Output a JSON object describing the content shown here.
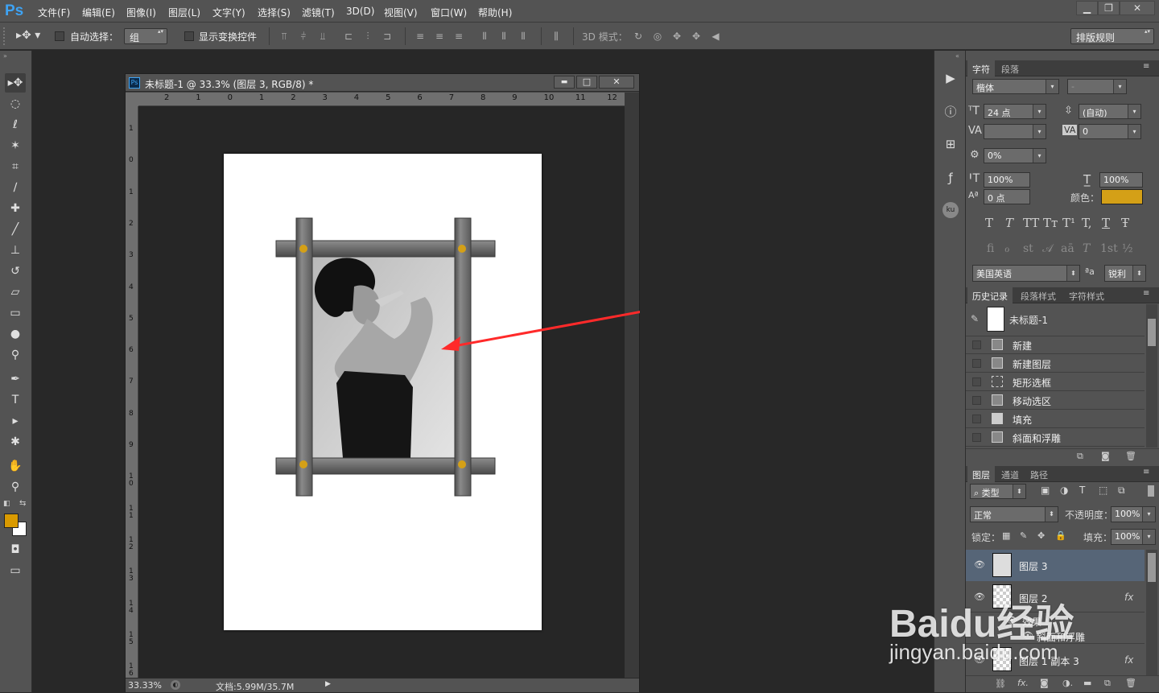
{
  "app": {
    "logo": "Ps"
  },
  "menu": [
    "文件(F)",
    "编辑(E)",
    "图像(I)",
    "图层(L)",
    "文字(Y)",
    "选择(S)",
    "滤镜(T)",
    "3D(D)",
    "视图(V)",
    "窗口(W)",
    "帮助(H)"
  ],
  "window_controls": {
    "minimize": "▁",
    "restore": "❐",
    "close": "✕"
  },
  "options": {
    "auto_select_label": "自动选择：",
    "auto_select_value": "组",
    "show_transform_label": "显示变换控件",
    "mode3d_label": "3D 模式：",
    "workspace": "排版规则"
  },
  "document": {
    "title": "未标题-1 @ 33.3% (图层 3, RGB/8) *",
    "icon": "Ps",
    "zoom": "33.33%",
    "doc_info": "文档:5.99M/35.7M",
    "ruler_top": [
      "2",
      "1",
      "0",
      "1",
      "2",
      "3",
      "4",
      "5",
      "6",
      "7",
      "8",
      "9",
      "10",
      "11",
      "12"
    ],
    "ruler_left": [
      "1",
      "0",
      "1",
      "2",
      "3",
      "4",
      "5",
      "6",
      "7",
      "8",
      "9",
      "10",
      "11",
      "12",
      "13",
      "14",
      "15",
      "16"
    ],
    "controls": {
      "minimize": "▬",
      "restore": "□",
      "close": "✕"
    }
  },
  "colors": {
    "foreground": "#d99a00",
    "background": "#ffffff",
    "accent": "#d4a017",
    "arrow": "#ff2a2a"
  },
  "character_panel": {
    "tabs": [
      "字符",
      "段落"
    ],
    "font_family": "楷体",
    "font_style": "-",
    "font_size": "24 点",
    "leading": "(自动)",
    "kerning": "",
    "tracking": "0",
    "scale_percent": "0%",
    "vscale": "100%",
    "hscale": "100%",
    "baseline": "0 点",
    "color_label": "颜色：",
    "type_buttons": [
      "T",
      "T",
      "TT",
      "Tт",
      "T¹",
      "T,",
      "T",
      "Ŧ"
    ],
    "opentype_buttons": [
      "fi",
      "ℴ",
      "st",
      "𝒜",
      "aā",
      "T",
      "1st",
      "½"
    ],
    "language": "美国英语",
    "aa_label": "ªa",
    "antialias": "锐利"
  },
  "history_panel": {
    "tabs": [
      "历史记录",
      "段落样式",
      "字符样式"
    ],
    "snapshot": "未标题-1",
    "steps": [
      "新建",
      "新建图层",
      "矩形选框",
      "移动选区",
      "填充",
      "斜面和浮雕"
    ]
  },
  "layers_panel": {
    "tabs": [
      "图层",
      "通道",
      "路径"
    ],
    "filter": "类型",
    "blend_mode": "正常",
    "opacity_label": "不透明度：",
    "opacity": "100%",
    "lock_label": "锁定：",
    "fill_label": "填充：",
    "fill": "100%",
    "layers": [
      {
        "name": "图层 3",
        "fx": ""
      },
      {
        "name": "图层 2",
        "fx": "fx"
      },
      {
        "name": "效果",
        "fx": ""
      },
      {
        "name": "斜面和浮雕",
        "fx": ""
      },
      {
        "name": "图层 1 副本 3",
        "fx": "fx"
      }
    ]
  },
  "watermark": {
    "brand": "Baidu经验",
    "url": "jingyan.baidu.com"
  }
}
